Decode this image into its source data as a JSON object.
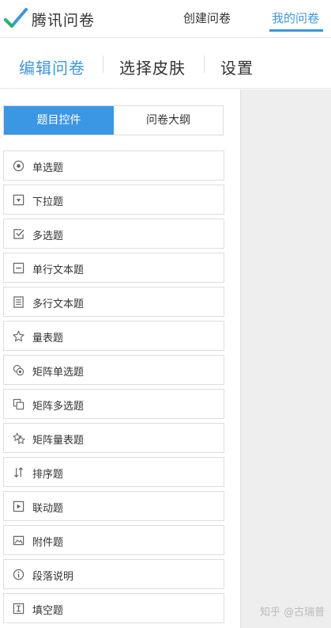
{
  "header": {
    "brand": "腾讯问卷",
    "nav": [
      {
        "label": "创建问卷"
      },
      {
        "label": "我的问卷"
      }
    ],
    "accent_color": "#3b97e3"
  },
  "subtabs": [
    {
      "label": "编辑问卷"
    },
    {
      "label": "选择皮肤"
    },
    {
      "label": "设置"
    }
  ],
  "panel_tabs": [
    {
      "label": "题目控件"
    },
    {
      "label": "问卷大纲"
    }
  ],
  "question_types": [
    {
      "label": "单选题",
      "icon": "radio-icon"
    },
    {
      "label": "下拉题",
      "icon": "dropdown-icon"
    },
    {
      "label": "多选题",
      "icon": "checkbox-icon"
    },
    {
      "label": "单行文本题",
      "icon": "single-line-text-icon"
    },
    {
      "label": "多行文本题",
      "icon": "multi-line-text-icon"
    },
    {
      "label": "量表题",
      "icon": "star-icon"
    },
    {
      "label": "矩阵单选题",
      "icon": "matrix-radio-icon"
    },
    {
      "label": "矩阵多选题",
      "icon": "matrix-checkbox-icon"
    },
    {
      "label": "矩阵量表题",
      "icon": "matrix-star-icon"
    },
    {
      "label": "排序题",
      "icon": "sort-icon"
    },
    {
      "label": "联动题",
      "icon": "play-icon"
    },
    {
      "label": "附件题",
      "icon": "image-icon"
    },
    {
      "label": "段落说明",
      "icon": "info-icon"
    },
    {
      "label": "填空题",
      "icon": "fill-blank-icon"
    }
  ],
  "watermark": "知乎 @古瑞普"
}
